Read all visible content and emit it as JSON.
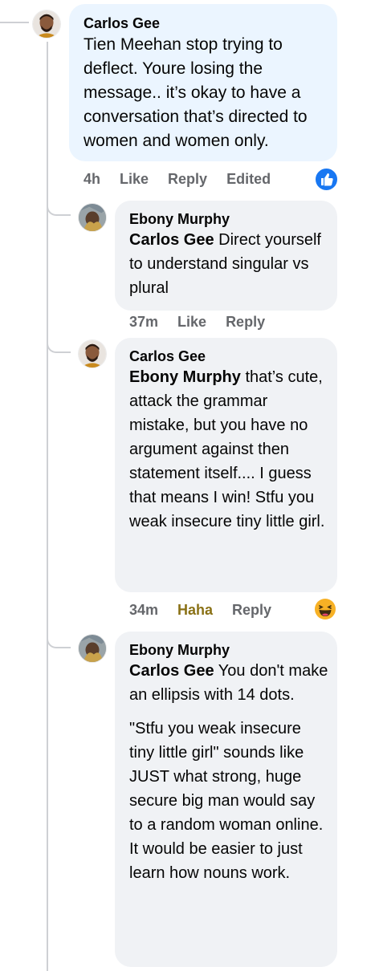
{
  "comments": [
    {
      "author": "Carlos Gee",
      "text": "Tien Meehan stop trying to deflect. Youre losing the message.. it’s okay to have a conversation that’s directed to women and women only.",
      "actions": {
        "time": "4h",
        "like": "Like",
        "reply": "Reply",
        "edited": "Edited"
      },
      "reaction_icon": "like-thumb-icon",
      "reaction_color": "#1877f2"
    },
    {
      "author": "Ebony Murphy",
      "mention": "Carlos Gee",
      "text": " Direct yourself to understand singular vs plural",
      "actions": {
        "time": "37m",
        "like": "Like",
        "reply": "Reply"
      }
    },
    {
      "author": "Carlos Gee",
      "mention": "Ebony Murphy",
      "text": " that’s cute, attack the grammar mistake, but you have no argument against then statement itself.... I guess that means I win! Stfu you weak insecure tiny little girl.",
      "actions": {
        "time": "34m",
        "like": "Haha",
        "reply": "Reply"
      },
      "reaction_icon": "haha-emoji-icon",
      "reaction_color": "#f7b125"
    },
    {
      "author": "Ebony Murphy",
      "mention": "Carlos Gee",
      "text": " You don't make an ellipsis with 14 dots.",
      "text2": "\"Stfu you weak insecure tiny little girl\" sounds like JUST what strong, huge secure big man would say to a random woman online. It would be easier to just learn how nouns work."
    }
  ],
  "colors": {
    "main_bubble": "#ebf5ff",
    "reply_bubble": "#f0f2f5",
    "action_text": "#65676b",
    "haha_text": "#8a7116",
    "thread_line": "#ced0d4"
  }
}
